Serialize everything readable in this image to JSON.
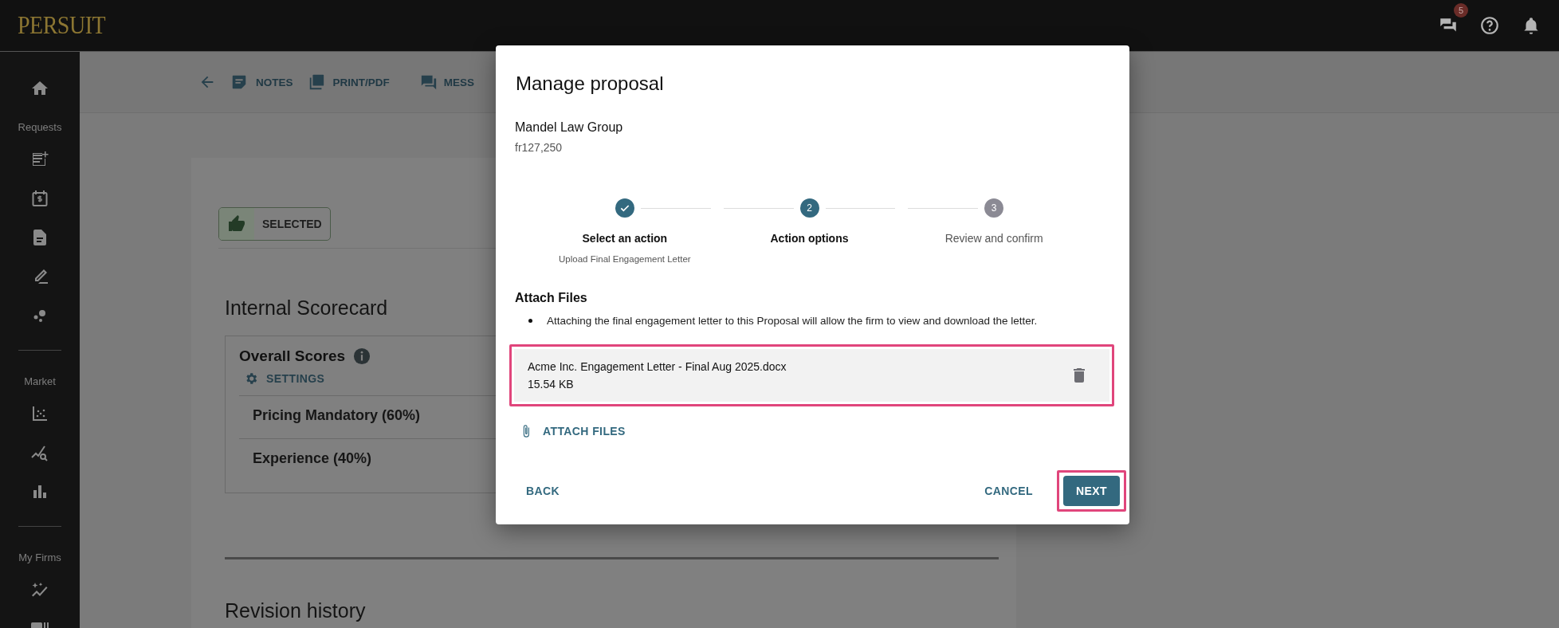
{
  "header": {
    "logo": "PERSUIT",
    "messages_badge": "5"
  },
  "sidebar": {
    "section_labels": [
      "Requests",
      "Market",
      "My Firms"
    ]
  },
  "toolbar": {
    "items": [
      {
        "kind": "notes",
        "label": "NOTES"
      },
      {
        "kind": "pdf",
        "label": "PRINT/PDF"
      },
      {
        "kind": "messages",
        "label": "MESS"
      }
    ]
  },
  "card": {
    "status_chip": "SELECTED",
    "scorecard_title": "Internal Scorecard",
    "overall_title": "Overall Scores",
    "settings_link": "SETTINGS",
    "criteria": [
      "Pricing Mandatory (60%)",
      "Experience (40%)"
    ],
    "revision_title": "Revision history"
  },
  "modal": {
    "title": "Manage proposal",
    "firm": "Mandel Law Group",
    "amount": "fr127,250",
    "steps": [
      {
        "completed": true,
        "selected": false,
        "label": "Select an action",
        "sublabel": "Upload Final Engagement Letter"
      },
      {
        "completed": false,
        "selected": true,
        "number": "2",
        "label": "Action options"
      },
      {
        "completed": false,
        "selected": false,
        "number": "3",
        "label": "Review and confirm"
      }
    ],
    "section_title": "Attach Files",
    "bullets": [
      "Attaching the final engagement letter to this Proposal will allow the firm to view and download the letter."
    ],
    "files": [
      {
        "name": "Acme Inc. Engagement Letter - Final Aug 2025.docx",
        "size": "15.54 KB",
        "highlighted": true
      }
    ],
    "attach_link": "ATTACH FILES",
    "buttons": {
      "back": "BACK",
      "cancel": "CANCEL",
      "next": "NEXT",
      "next_highlighted": true
    }
  }
}
